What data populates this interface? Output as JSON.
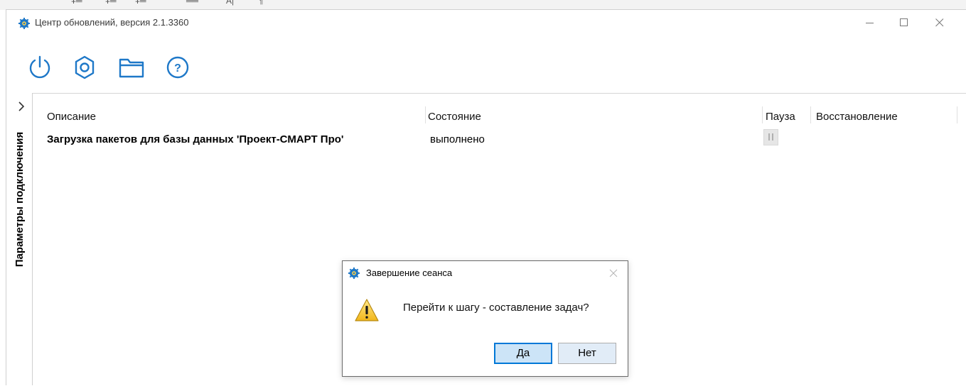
{
  "window": {
    "title": "Центр обновлений, версия 2.1.3360"
  },
  "toolbar": {
    "buttons": [
      {
        "name": "power",
        "icon": "power-icon"
      },
      {
        "name": "settings",
        "icon": "gear-icon"
      },
      {
        "name": "open-folder",
        "icon": "folder-icon"
      },
      {
        "name": "help",
        "icon": "help-icon"
      }
    ],
    "accent_color": "#1e78c8"
  },
  "sidebar": {
    "label": "Параметры подключения",
    "icon": "chevron-right-icon"
  },
  "table": {
    "columns": [
      "Описание",
      "Состояние",
      "Пауза",
      "Восстановление"
    ],
    "rows": [
      {
        "description": "Загрузка пакетов для базы данных 'Проект-СМАРТ Про'",
        "state": "выполнено"
      }
    ]
  },
  "dialog": {
    "title": "Завершение сеанса",
    "message": "Перейти к шагу - составление задач?",
    "yes_label": "Да",
    "no_label": "Нет"
  }
}
